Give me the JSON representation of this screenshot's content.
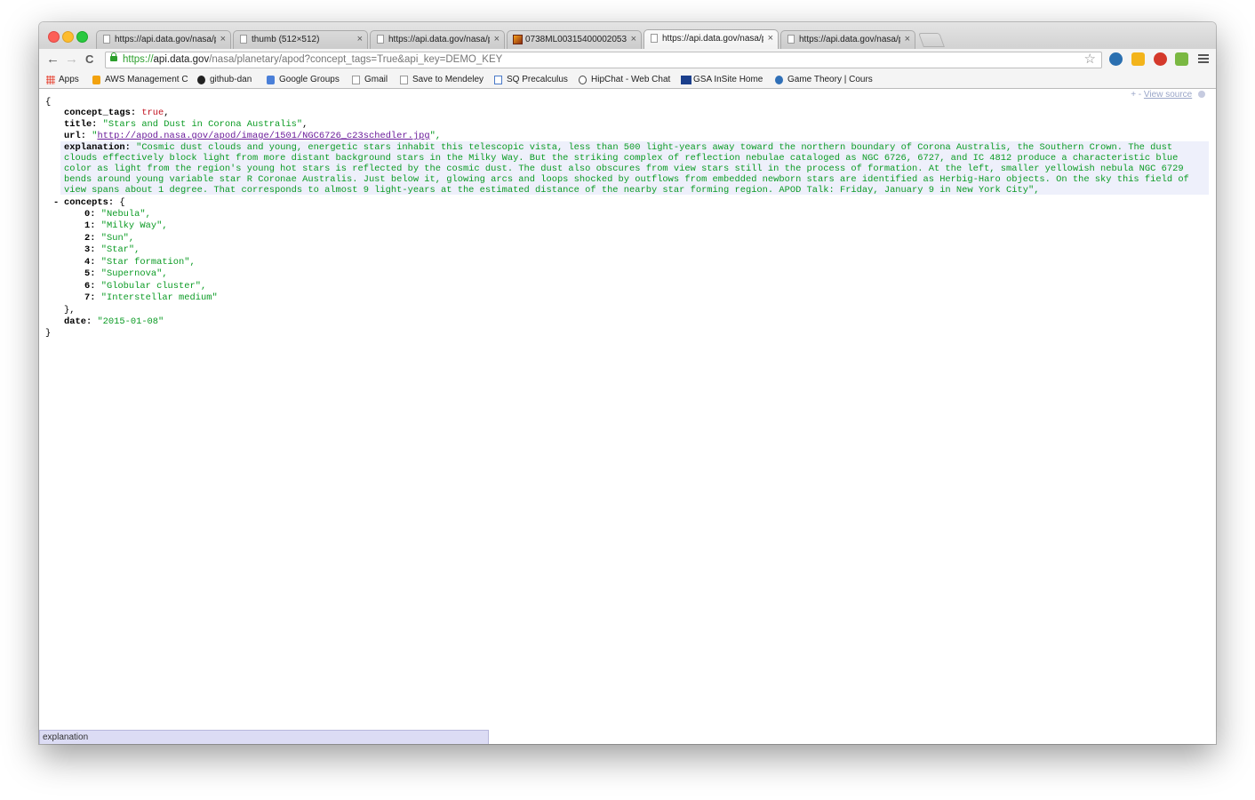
{
  "tabs": [
    {
      "label": "https://api.data.gov/nasa/p",
      "active": false,
      "favicon": "page-icon"
    },
    {
      "label": "thumb (512×512)",
      "active": false,
      "favicon": "page-icon"
    },
    {
      "label": "https://api.data.gov/nasa/p",
      "active": false,
      "favicon": "page-icon"
    },
    {
      "label": "0738ML00315400002053",
      "active": false,
      "favicon": "image-thumbnail-icon"
    },
    {
      "label": "https://api.data.gov/nasa/p",
      "active": true,
      "favicon": "page-icon"
    },
    {
      "label": "https://api.data.gov/nasa/p",
      "active": false,
      "favicon": "page-icon"
    }
  ],
  "tab_close": "×",
  "toolbar": {
    "back": "←",
    "forward": "→",
    "reload": "C",
    "url_scheme": "https://",
    "url_host": "api.data.gov",
    "url_path": "/nasa/planetary/apod?concept_tags=True&api_key=DEMO_KEY",
    "star": "☆"
  },
  "bookmarks": [
    {
      "label": "Apps",
      "icon": "apps-grid-icon"
    },
    {
      "label": "AWS Management C",
      "icon": "aws-icon"
    },
    {
      "label": "github-dan",
      "icon": "github-icon"
    },
    {
      "label": "Google Groups",
      "icon": "google-groups-icon"
    },
    {
      "label": "Gmail",
      "icon": "page-icon"
    },
    {
      "label": "Save to Mendeley",
      "icon": "page-icon"
    },
    {
      "label": "SQ Precalculus",
      "icon": "sq-icon"
    },
    {
      "label": "HipChat - Web Chat",
      "icon": "hipchat-icon"
    },
    {
      "label": "GSA InSite Home",
      "icon": "gsa-icon"
    },
    {
      "label": "Game Theory | Cours",
      "icon": "coursera-icon"
    }
  ],
  "viewer": {
    "toggle": "+ -",
    "view_source": "View source"
  },
  "json": {
    "open_brace": "{",
    "close_brace": "}",
    "concept_tags_key": "concept_tags:",
    "concept_tags_val": "true",
    "title_key": "title:",
    "title_val": "\"Stars and Dust in Corona Australis\"",
    "url_key": "url:",
    "url_quote_open": "\"",
    "url_val": "http://apod.nasa.gov/apod/image/1501/NGC6726_c23schedler.jpg",
    "url_quote_close": "\",",
    "explanation_key": "explanation:",
    "explanation_val": "\"Cosmic dust clouds and young, energetic stars inhabit this telescopic vista, less than 500 light-years away toward the northern boundary of Corona Australis, the Southern Crown. The dust clouds effectively block light from more distant background stars in the Milky Way. But the striking complex of reflection nebulae cataloged as NGC 6726, 6727, and IC 4812 produce a characteristic blue color as light from the region's young hot stars is reflected by the cosmic dust. The dust also obscures from view stars still in the process of formation. At the left, smaller yellowish nebula NGC 6729 bends around young variable star R Coronae Australis. Just below it, glowing arcs and loops shocked by outflows from embedded newborn stars are identified as Herbig-Haro objects. On the sky this field of view spans about 1 degree. That corresponds to almost 9 light-years at the estimated distance of the nearby star forming region. APOD Talk: Friday, January 9 in New York City\",",
    "collapse_toggle": "-",
    "concepts_key": "concepts:",
    "concepts_open": "{",
    "concepts": [
      {
        "index": "0:",
        "value": "\"Nebula\","
      },
      {
        "index": "1:",
        "value": "\"Milky Way\","
      },
      {
        "index": "2:",
        "value": "\"Sun\","
      },
      {
        "index": "3:",
        "value": "\"Star\","
      },
      {
        "index": "4:",
        "value": "\"Star formation\","
      },
      {
        "index": "5:",
        "value": "\"Supernova\","
      },
      {
        "index": "6:",
        "value": "\"Globular cluster\","
      },
      {
        "index": "7:",
        "value": "\"Interstellar medium\""
      }
    ],
    "concepts_close": "},",
    "date_key": "date:",
    "date_val": "\"2015-01-08\""
  },
  "status_bar": "explanation"
}
